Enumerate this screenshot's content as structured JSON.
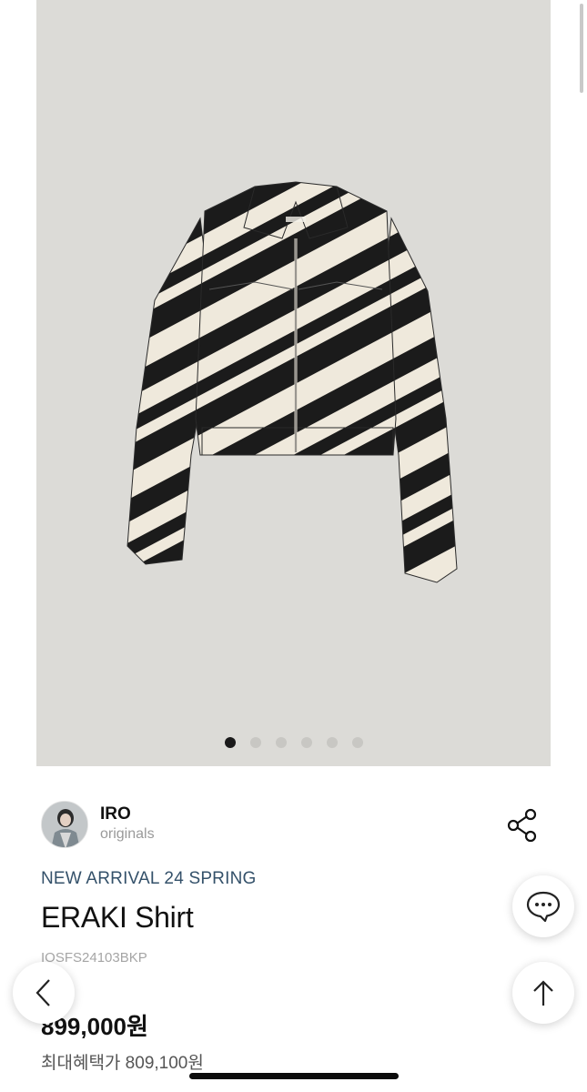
{
  "gallery": {
    "image_alt": "zebra-print-cropped-jacket",
    "dot_count": 6,
    "active_index": 0
  },
  "brand": {
    "name": "IRO",
    "subtitle": "originals"
  },
  "product": {
    "tag": "NEW ARRIVAL 24 SPRING",
    "name": "ERAKI Shirt",
    "code": "IOSFS24103BKP",
    "price": "899,000원",
    "max_benefit_price": "최대혜택가 809,100원"
  },
  "icons": {
    "share": "share-icon",
    "chat": "chat-bubble-icon",
    "scroll_top": "arrow-up-icon",
    "back": "chevron-left-icon"
  },
  "colors": {
    "gallery_bg": "#dcdbd7",
    "tag_color": "#34516a",
    "dot_active": "#1a1a1a"
  }
}
